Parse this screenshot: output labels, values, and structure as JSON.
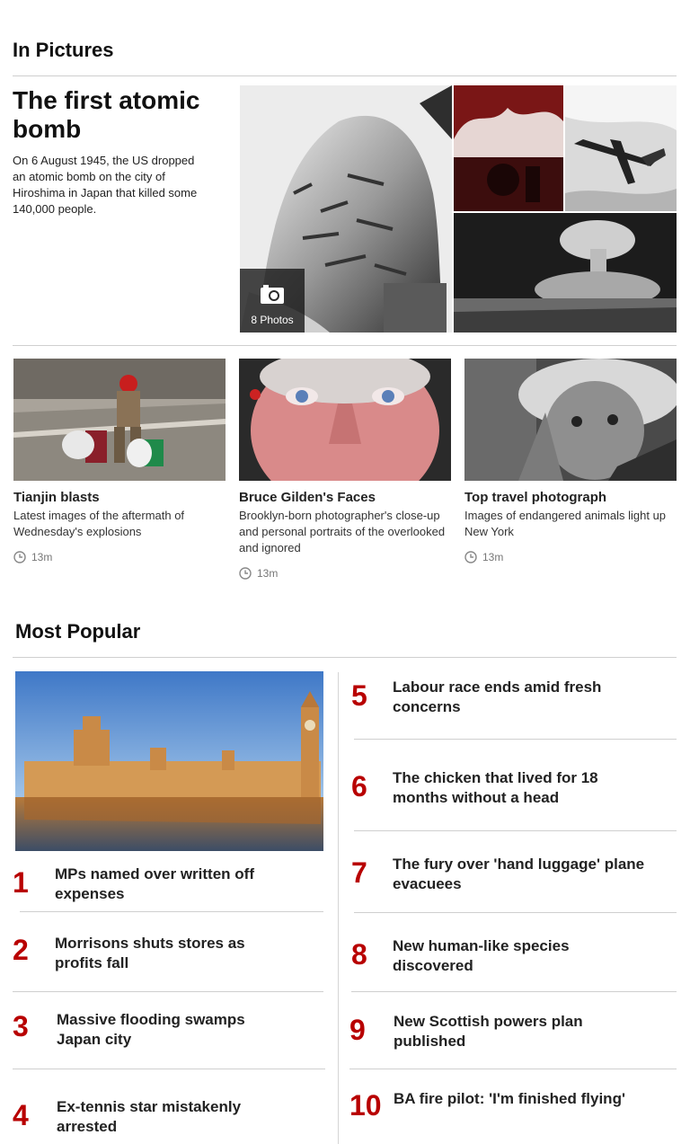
{
  "in_pictures": {
    "section_title": "In Pictures",
    "feature": {
      "headline": "The first atomic bomb",
      "summary": "On 6 August 1945, the US dropped an atomic bomb on the city of Hiroshima in Japan that killed some 140,000 people.",
      "photo_count_label": "8 Photos",
      "photo_count_icon": "camera-icon"
    },
    "cards": [
      {
        "title": "Tianjin blasts",
        "description": "Latest images of the aftermath of Wednesday's explosions",
        "time": "13m"
      },
      {
        "title": "Bruce Gilden's Faces",
        "description": "Brooklyn-born photographer's close-up and personal portraits of the overlooked and ignored",
        "time": "13m"
      },
      {
        "title": "Top travel photograph",
        "description": "Images of endangered animals light up New York",
        "time": "13m"
      }
    ]
  },
  "most_popular": {
    "section_title": "Most Popular",
    "items": [
      {
        "rank": "1",
        "title": "MPs named over written off expenses"
      },
      {
        "rank": "2",
        "title": "Morrisons shuts stores as profits fall"
      },
      {
        "rank": "3",
        "title": "Massive flooding swamps Japan city"
      },
      {
        "rank": "4",
        "title": "Ex-tennis star mistakenly arrested"
      },
      {
        "rank": "5",
        "title": "Labour race ends amid fresh concerns"
      },
      {
        "rank": "6",
        "title": "The chicken that lived for 18 months without a head"
      },
      {
        "rank": "7",
        "title": "The fury over 'hand luggage' plane evacuees"
      },
      {
        "rank": "8",
        "title": "New human-like species discovered"
      },
      {
        "rank": "9",
        "title": "New Scottish powers plan published"
      },
      {
        "rank": "10",
        "title": "BA fire pilot: 'I'm finished flying'"
      }
    ]
  },
  "colors": {
    "rank_red": "#b80000",
    "text": "#222222",
    "rule": "#cfcfcf",
    "time_grey": "#777777"
  }
}
